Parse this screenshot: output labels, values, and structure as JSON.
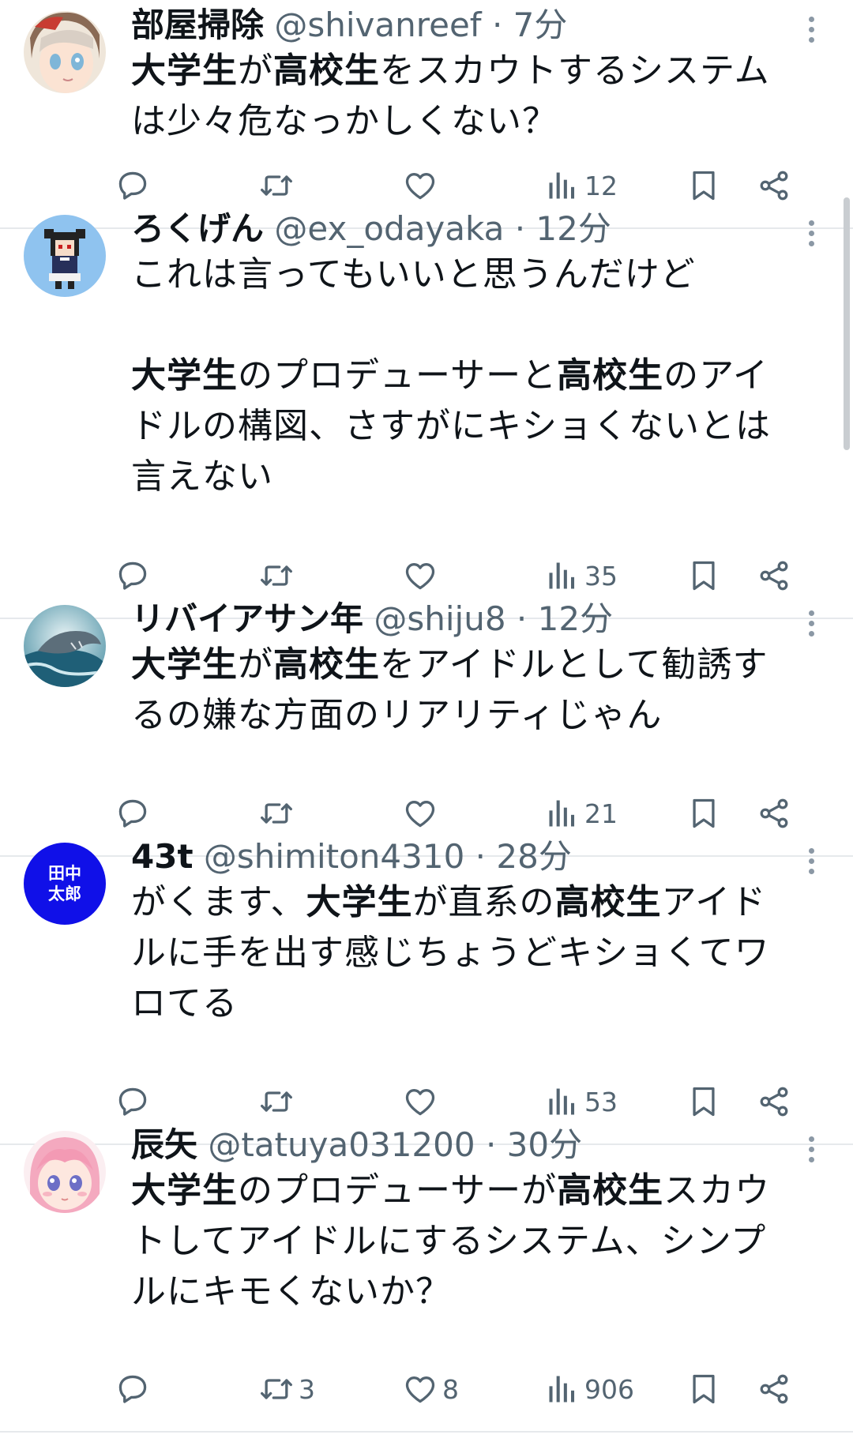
{
  "tweets": [
    {
      "name": "部屋掃除",
      "handle": "@shivanreef",
      "time": "7分",
      "lines": [
        [
          {
            "t": "大学生",
            "hl": true
          },
          {
            "t": "が"
          },
          {
            "t": "高校生",
            "hl": true
          },
          {
            "t": "をスカウトするシステム"
          }
        ],
        [
          {
            "t": "は少々危なっかしくない？"
          }
        ]
      ],
      "stats": {
        "reply": "",
        "retweet": "",
        "like": "",
        "views": "12"
      },
      "avatar": "anime-girl-avatar"
    },
    {
      "name": "ろくげん",
      "handle": "@ex_odayaka",
      "time": "12分",
      "lines": [
        [
          {
            "t": "これは言ってもいいと思うんだけど"
          }
        ],
        [],
        [
          {
            "t": "大学生",
            "hl": true
          },
          {
            "t": "のプロデューサーと"
          },
          {
            "t": "高校生",
            "hl": true
          },
          {
            "t": "のアイ"
          }
        ],
        [
          {
            "t": "ドルの構図、さすがにキショくないとは"
          }
        ],
        [
          {
            "t": "言えない"
          }
        ]
      ],
      "stats": {
        "reply": "",
        "retweet": "",
        "like": "",
        "views": "35"
      },
      "avatar": "pixel-art-avatar"
    },
    {
      "name": "リバイアサン年",
      "handle": "@shiju8",
      "time": "12分",
      "lines": [
        [
          {
            "t": "大学生",
            "hl": true
          },
          {
            "t": "が"
          },
          {
            "t": "高校生",
            "hl": true
          },
          {
            "t": "をアイドルとして勧誘す"
          }
        ],
        [
          {
            "t": "るの嫌な方面のリアリティじゃん"
          }
        ]
      ],
      "stats": {
        "reply": "",
        "retweet": "",
        "like": "",
        "views": "21"
      },
      "avatar": "whale-avatar"
    },
    {
      "name": "43t",
      "handle": "@shimiton4310",
      "time": "28分",
      "lines": [
        [
          {
            "t": "がくます、"
          },
          {
            "t": "大学生",
            "hl": true
          },
          {
            "t": "が直系の"
          },
          {
            "t": "高校生",
            "hl": true
          },
          {
            "t": "アイド"
          }
        ],
        [
          {
            "t": "ルに手を出す感じちょうどキショくてワ"
          }
        ],
        [
          {
            "t": "ロてる"
          }
        ]
      ],
      "stats": {
        "reply": "",
        "retweet": "",
        "like": "",
        "views": "53"
      },
      "avatar": "text-avatar",
      "avatar_text": [
        "田中",
        "太郎"
      ]
    },
    {
      "name": "辰矢",
      "handle": "@tatuya031200",
      "time": "30分",
      "lines": [
        [
          {
            "t": "大学生",
            "hl": true
          },
          {
            "t": "のプロデューサーが"
          },
          {
            "t": "高校生",
            "hl": true
          },
          {
            "t": "スカウ"
          }
        ],
        [
          {
            "t": "トしてアイドルにするシステム、シンプ"
          }
        ],
        [
          {
            "t": "ルにキモくないか？"
          }
        ]
      ],
      "stats": {
        "reply": "",
        "retweet": "3",
        "like": "8",
        "views": "906"
      },
      "avatar": "pink-hair-avatar"
    }
  ],
  "separator": "·",
  "colors": {
    "text": "#0f1419",
    "secondary": "#536471",
    "divider": "#e6e9ec",
    "text_avatar_bg": "#1010e8"
  }
}
